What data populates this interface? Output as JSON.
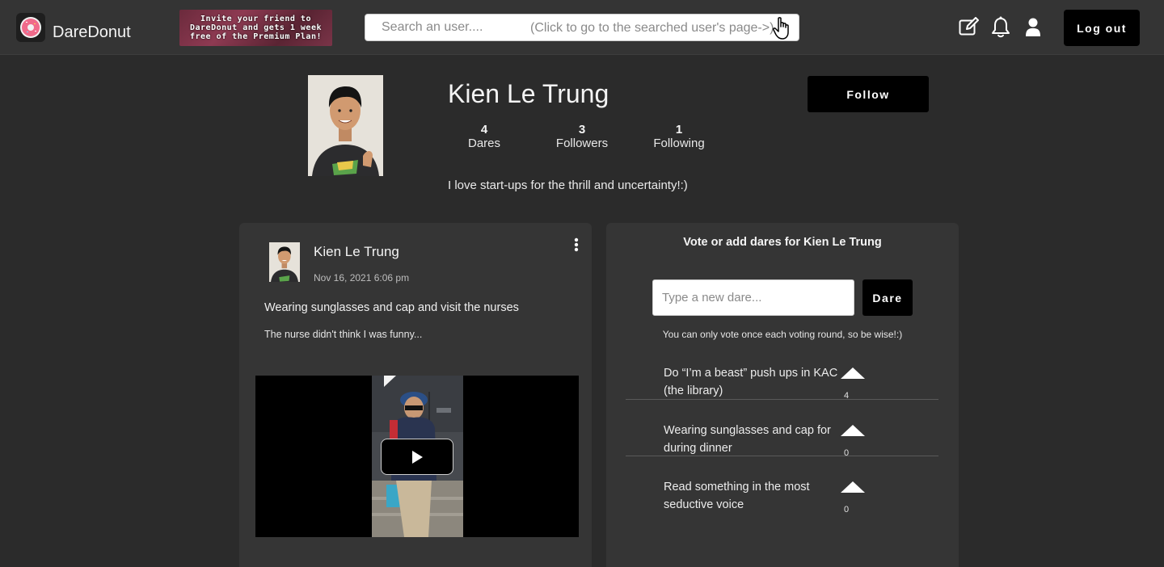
{
  "header": {
    "brand": "DareDonut",
    "promo": "Invite your friend to DareDonut and gets 1 week free of the Premium Plan!",
    "search_placeholder": "Search an user....",
    "search_hint": "(Click  to go to the searched user's page->)",
    "logout_label": "Log out",
    "icons": [
      "edit-icon",
      "bell-icon",
      "user-icon"
    ]
  },
  "profile": {
    "name": "Kien Le Trung",
    "stats": [
      {
        "value": "4",
        "label": "Dares"
      },
      {
        "value": "3",
        "label": "Followers"
      },
      {
        "value": "1",
        "label": "Following"
      }
    ],
    "bio": "I love start-ups for the thrill and uncertainty!:)",
    "follow_label": "Follow"
  },
  "post": {
    "author": "Kien Le Trung",
    "date": "Nov 16, 2021 6:06 pm",
    "title": "Wearing sunglasses and cap and visit the nurses",
    "text": "The nurse didn't think I was funny..."
  },
  "dares": {
    "title": "Vote or add dares for Kien Le Trung",
    "input_placeholder": "Type a new dare...",
    "button_label": "Dare",
    "note": "You can only vote once each voting round, so be wise!:)",
    "items": [
      {
        "text": "Do “I’m a beast” push ups in KAC (the library)",
        "votes": "4"
      },
      {
        "text": "Wearing sunglasses and cap for during dinner",
        "votes": "0"
      },
      {
        "text": "Read something in the most seductive voice",
        "votes": "0"
      }
    ]
  }
}
